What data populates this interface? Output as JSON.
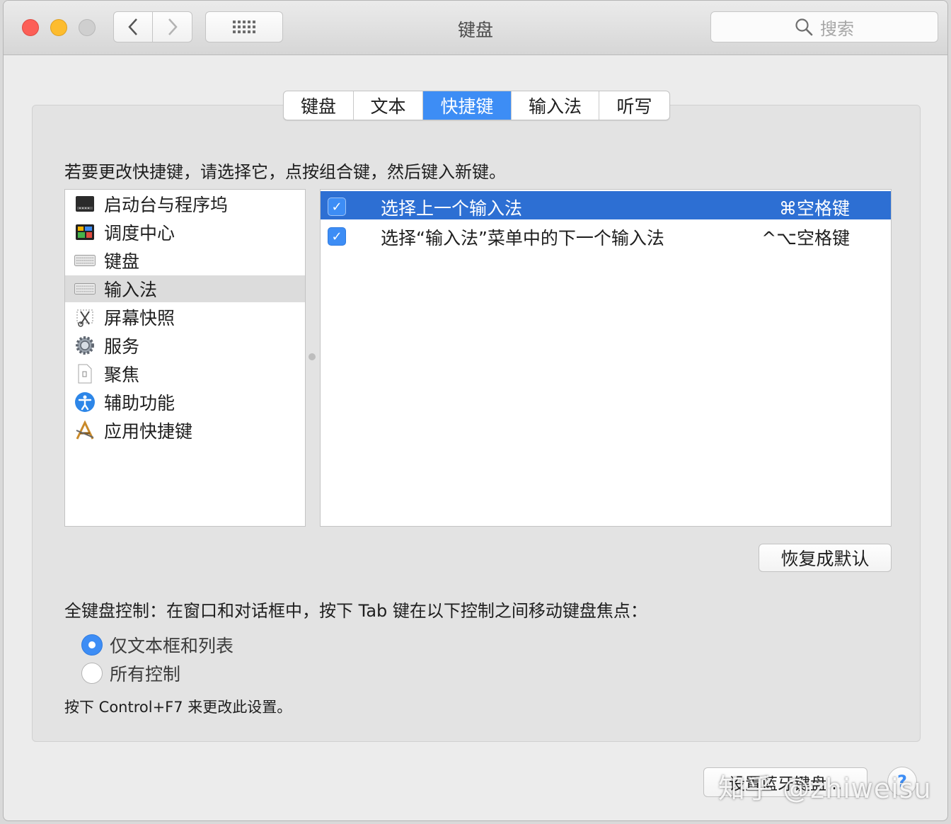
{
  "window": {
    "title": "键盘"
  },
  "toolbar": {
    "search_placeholder": "搜索"
  },
  "tabs": [
    {
      "label": "键盘",
      "active": false
    },
    {
      "label": "文本",
      "active": false
    },
    {
      "label": "快捷键",
      "active": true
    },
    {
      "label": "输入法",
      "active": false
    },
    {
      "label": "听写",
      "active": false
    }
  ],
  "instruction": "若要更改快捷键，请选择它，点按组合键，然后键入新键。",
  "categories": [
    {
      "label": "启动台与程序坞",
      "icon": "launchpad-dock-icon"
    },
    {
      "label": "调度中心",
      "icon": "mission-control-icon"
    },
    {
      "label": "键盘",
      "icon": "keyboard-icon"
    },
    {
      "label": "输入法",
      "icon": "keyboard-icon",
      "selected": true
    },
    {
      "label": "屏幕快照",
      "icon": "screenshot-icon"
    },
    {
      "label": "服务",
      "icon": "gear-icon"
    },
    {
      "label": "聚焦",
      "icon": "document-icon"
    },
    {
      "label": "辅助功能",
      "icon": "accessibility-icon"
    },
    {
      "label": "应用快捷键",
      "icon": "app-store-icon"
    }
  ],
  "shortcuts": [
    {
      "label": "选择上一个输入法",
      "key": "⌘空格键",
      "checked": true,
      "selected": true
    },
    {
      "label": "选择“输入法”菜单中的下一个输入法",
      "key": "^⌥空格键",
      "checked": true,
      "selected": false
    }
  ],
  "restore_defaults_label": "恢复成默认",
  "full_keyboard_access": {
    "label": "全键盘控制：在窗口和对话框中，按下 Tab 键在以下控制之间移动键盘焦点：",
    "options": [
      {
        "label": "仅文本框和列表",
        "selected": true
      },
      {
        "label": "所有控制",
        "selected": false
      }
    ],
    "hint": "按下 Control+F7 来更改此设置。"
  },
  "bluetooth_button_label": "设置蓝牙键盘...",
  "help_label": "?",
  "watermark": "知乎 @zhiweisu",
  "colors": {
    "accent": "#3d8df5",
    "selection": "#2d6fd3",
    "close": "#fc5f57",
    "minimize": "#fdbc2e"
  }
}
